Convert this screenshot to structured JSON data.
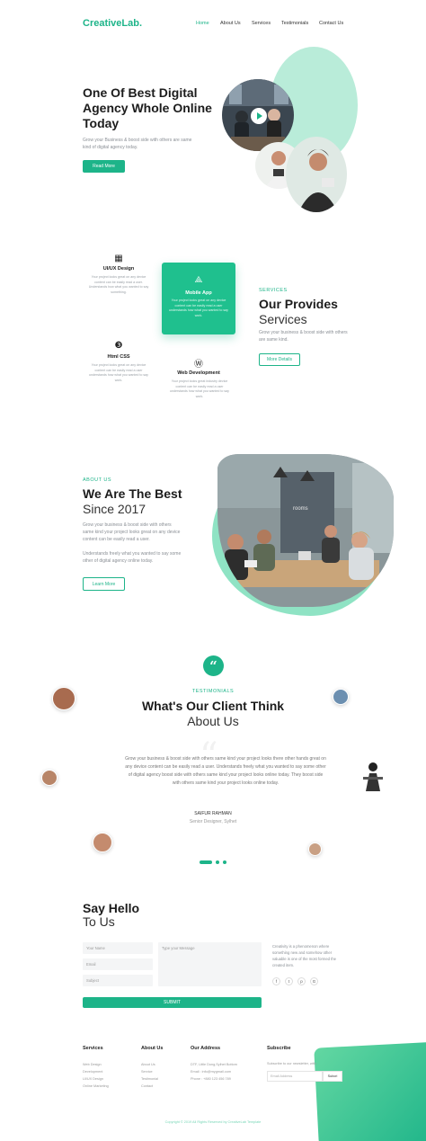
{
  "brand": {
    "logo": "CreativeLab.",
    "accent": "#1db489"
  },
  "nav": {
    "items": [
      "Home",
      "About Us",
      "Services",
      "Testimonials",
      "Contact Us"
    ],
    "active": "Home"
  },
  "hero": {
    "title": "One Of Best Digital Agency Whole Online Today",
    "subtitle": "Grow your Business & boost side with others are same kind of digital agency today.",
    "cta": "Read More"
  },
  "services": {
    "tag": "SERVICES",
    "title_bold": "Our Provides",
    "title_light": "Services",
    "desc": "Grow your business & boost side with others are same kind.",
    "cta": "More Details",
    "items": [
      {
        "icon": "layout-icon",
        "glyph": "▦",
        "title": "UI/UX Design",
        "desc": "Your project looks great on any device content can be easily read a user. Understands how what you wanted to say something."
      },
      {
        "icon": "app-icon",
        "glyph": "⟁",
        "title": "Mobile App",
        "desc": "Your project looks great on any device content can be easily read a user understands how what you wanted to say work."
      },
      {
        "icon": "css-icon",
        "glyph": "❸",
        "title": "Html CSS",
        "desc": "Your project looks great on any device content can be easily read a user understands how what you wanted to say work."
      },
      {
        "icon": "wordpress-icon",
        "glyph": "Ⓦ",
        "title": "Web Development",
        "desc": "Your project looks great industry device content can be easily read a user understands how what you wanted to say work."
      }
    ]
  },
  "about": {
    "tag": "ABOUT US",
    "title_bold": "We Are The Best",
    "title_light": "Since 2017",
    "p1": "Grow your business & boost side with others same kind your project looks great on any device content can be easily read a user.",
    "p2": "Understands freely what you wanted to say some other of digital agency online today.",
    "cta": "Learn More"
  },
  "testimonials": {
    "tag": "TESTIMONIALS",
    "title_bold": "What's Our Client Think",
    "title_light": "About Us",
    "quote": "Grow your business & boost side with others same kind your project looks there other hands great on any device content can be easily read a user. Understands freely what you wanted to say some other of digital agency boost side with others same kind your project looks online today. They boost side with others same kind your project looks online today.",
    "name": "SAIFUR RAHMAN",
    "role": "Senior Designer, Sylhet"
  },
  "contact": {
    "title_bold": "Say Hello",
    "title_light": "To Us",
    "name_placeholder": "Your Name",
    "email_placeholder": "Email",
    "subject_placeholder": "Subject",
    "message_placeholder": "Type your Message",
    "submit": "SUBMIT",
    "info": "Creativity is a phenomenon where something new and somehow other valuable is one of the most formed the created item.",
    "socials": [
      "f",
      "t",
      "p",
      "G"
    ]
  },
  "footer": {
    "cols": [
      {
        "title": "Services",
        "links": [
          "Web Design",
          "Development",
          "UI/UX Design",
          "Online Marketing"
        ]
      },
      {
        "title": "About Us",
        "links": [
          "About Us",
          "Service",
          "Testimonial",
          "Contact"
        ]
      },
      {
        "title": "Our Address",
        "links": [
          "DTF, Little Dong,Sylhet Bottom",
          "Email : info@mygmail.com",
          "Phone : +880 123 456 789"
        ]
      }
    ],
    "subscribe": {
      "title": "Subscribe",
      "text": "Subscribe to our newsletter, with",
      "placeholder": "Email Address",
      "button": "Subcri"
    },
    "copyright": "Copyright © 2019 All Rights Reserved by CreativeLab Template"
  }
}
